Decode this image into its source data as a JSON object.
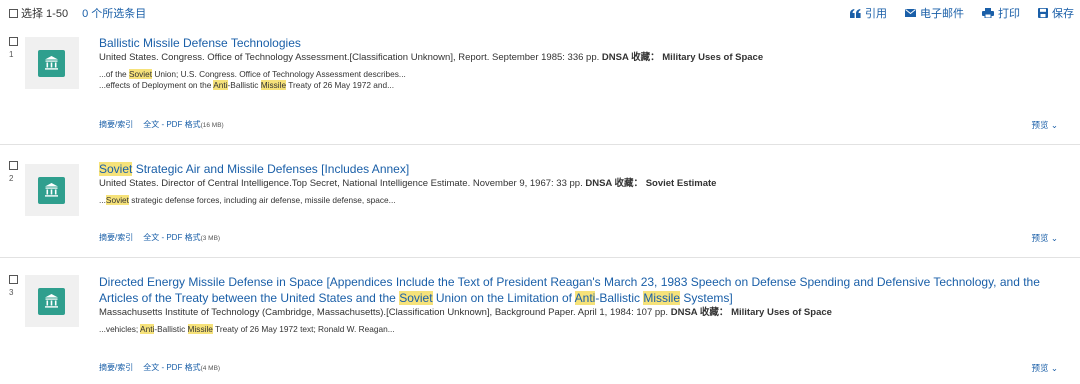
{
  "toolbar": {
    "select_range": "选择 1-50",
    "selected_count": "0 个所选条目",
    "cite": "引用",
    "email": "电子邮件",
    "print": "打印",
    "save": "保存"
  },
  "results": [
    {
      "num": "1",
      "title_parts": [
        {
          "t": "Ballistic Missile Defense Technologies",
          "hl": false
        }
      ],
      "meta": "United States. Congress. Office of Technology Assessment.[Classification Unknown], Report. September 1985: 336 pp.",
      "collection_label": "DNSA 收藏：",
      "collection": "Military Uses of Space",
      "snippets": [
        [
          {
            "t": "...of the ",
            "hl": false
          },
          {
            "t": "Soviet",
            "hl": true
          },
          {
            "t": " Union; U.S. Congress. Office of Technology Assessment describes...",
            "hl": false
          }
        ],
        [
          {
            "t": "...effects of Deployment on the ",
            "hl": false
          },
          {
            "t": "Anti",
            "hl": true
          },
          {
            "t": "-Ballistic ",
            "hl": false
          },
          {
            "t": "Missile",
            "hl": true
          },
          {
            "t": " Treaty of 26 May 1972 and...",
            "hl": false
          }
        ]
      ],
      "abstract_link": "摘要/索引",
      "fulltext_link": "全文 - PDF 格式",
      "size": "(16 MB)",
      "preview": "预览"
    },
    {
      "num": "2",
      "title_parts": [
        {
          "t": "Soviet",
          "hl": true
        },
        {
          "t": " Strategic Air and Missile Defenses [Includes Annex]",
          "hl": false
        }
      ],
      "meta": "United States. Director of Central Intelligence.Top Secret, National Intelligence Estimate. November 9, 1967: 33 pp.",
      "collection_label": "DNSA 收藏：",
      "collection": "Soviet Estimate",
      "snippets": [
        [
          {
            "t": "...",
            "hl": false
          },
          {
            "t": "Soviet",
            "hl": true
          },
          {
            "t": " strategic defense forces, including air defense, missile defense, space...",
            "hl": false
          }
        ]
      ],
      "abstract_link": "摘要/索引",
      "fulltext_link": "全文 - PDF 格式",
      "size": "(3 MB)",
      "preview": "预览"
    },
    {
      "num": "3",
      "title_parts": [
        {
          "t": "Directed Energy Missile Defense in Space [Appendices Include the Text of President Reagan's March 23, 1983 Speech on Defense Spending and Defensive Technology, and the Articles of the Treaty between the United States and the ",
          "hl": false
        },
        {
          "t": "Soviet",
          "hl": true
        },
        {
          "t": " Union on the Limitation of ",
          "hl": false
        },
        {
          "t": "Anti",
          "hl": true
        },
        {
          "t": "-Ballistic ",
          "hl": false
        },
        {
          "t": "Missile",
          "hl": true
        },
        {
          "t": " Systems]",
          "hl": false
        }
      ],
      "meta": "Massachusetts Institute of Technology (Cambridge, Massachusetts).[Classification Unknown], Background Paper. April 1, 1984: 107 pp.",
      "collection_label": "DNSA 收藏：",
      "collection": "Military Uses of Space",
      "snippets": [
        [
          {
            "t": "...vehicles; ",
            "hl": false
          },
          {
            "t": "Anti",
            "hl": true
          },
          {
            "t": "-Ballistic ",
            "hl": false
          },
          {
            "t": "Missile",
            "hl": true
          },
          {
            "t": " Treaty of 26 May 1972 text; Ronald W. Reagan...",
            "hl": false
          }
        ]
      ],
      "abstract_link": "摘要/索引",
      "fulltext_link": "全文 - PDF 格式",
      "size": "(4 MB)",
      "preview": "预览"
    }
  ]
}
